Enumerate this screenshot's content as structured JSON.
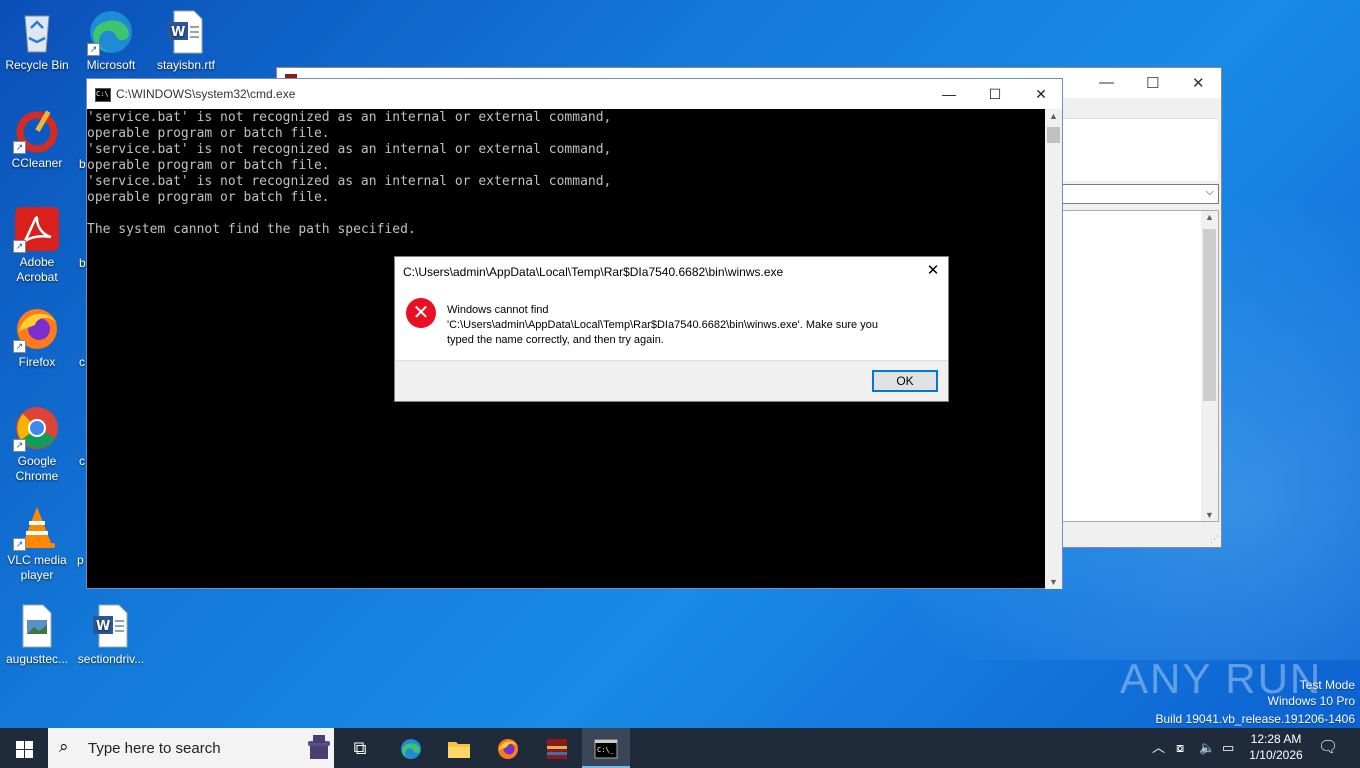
{
  "desktop_icons": [
    {
      "label": "Recycle Bin",
      "icon": "recycle-bin-icon"
    },
    {
      "label": "Microsoft Edge",
      "icon": "edge-icon"
    },
    {
      "label": "stayisbn.rtf",
      "icon": "word-document-icon"
    },
    {
      "label": "CCleaner",
      "icon": "ccleaner-icon"
    },
    {
      "label": "Adobe Acrobat",
      "icon": "acrobat-icon"
    },
    {
      "label": "Firefox",
      "icon": "firefox-icon"
    },
    {
      "label": "Google Chrome",
      "icon": "chrome-icon"
    },
    {
      "label": "VLC media player",
      "icon": "vlc-icon"
    },
    {
      "label": "augusttec...",
      "icon": "image-file-icon"
    },
    {
      "label": "sectiondriv...",
      "icon": "word-document-icon"
    }
  ],
  "desktop_partial_labels": [
    "b",
    "b",
    "c",
    "c",
    "p"
  ],
  "cmd_window": {
    "title": "C:\\WINDOWS\\system32\\cmd.exe",
    "lines": [
      "'service.bat' is not recognized as an internal or external command,",
      "operable program or batch file.",
      "'service.bat' is not recognized as an internal or external command,",
      "operable program or batch file.",
      "'service.bat' is not recognized as an internal or external command,",
      "operable program or batch file.",
      "",
      "The system cannot find the path specified."
    ]
  },
  "error_dialog": {
    "title": "C:\\Users\\admin\\AppData\\Local\\Temp\\Rar$DIa7540.6682\\bin\\winws.exe",
    "message_line1": "Windows cannot find",
    "message_line2": "'C:\\Users\\admin\\AppData\\Local\\Temp\\Rar$DIa7540.6682\\bin\\winws.exe'. Make sure you",
    "message_line3": "typed the name correctly, and then try again.",
    "ok_label": "OK",
    "icon": "error-icon"
  },
  "watermark": {
    "brand": "ANY RUN",
    "line1": "Test Mode",
    "line2": "Windows 10 Pro",
    "line3": "Build 19041.vb_release.191206-1406"
  },
  "taskbar": {
    "search_placeholder": "Type here to search",
    "apps": [
      "task-view-icon",
      "edge-icon",
      "file-explorer-icon",
      "firefox-icon",
      "winrar-icon",
      "cmd-icon"
    ],
    "time": "12:28 AM",
    "date": "1/10/2026"
  },
  "colors": {
    "error_red": "#e81123",
    "accent_blue": "#0078d7",
    "taskbar": "#1f2a3b"
  }
}
